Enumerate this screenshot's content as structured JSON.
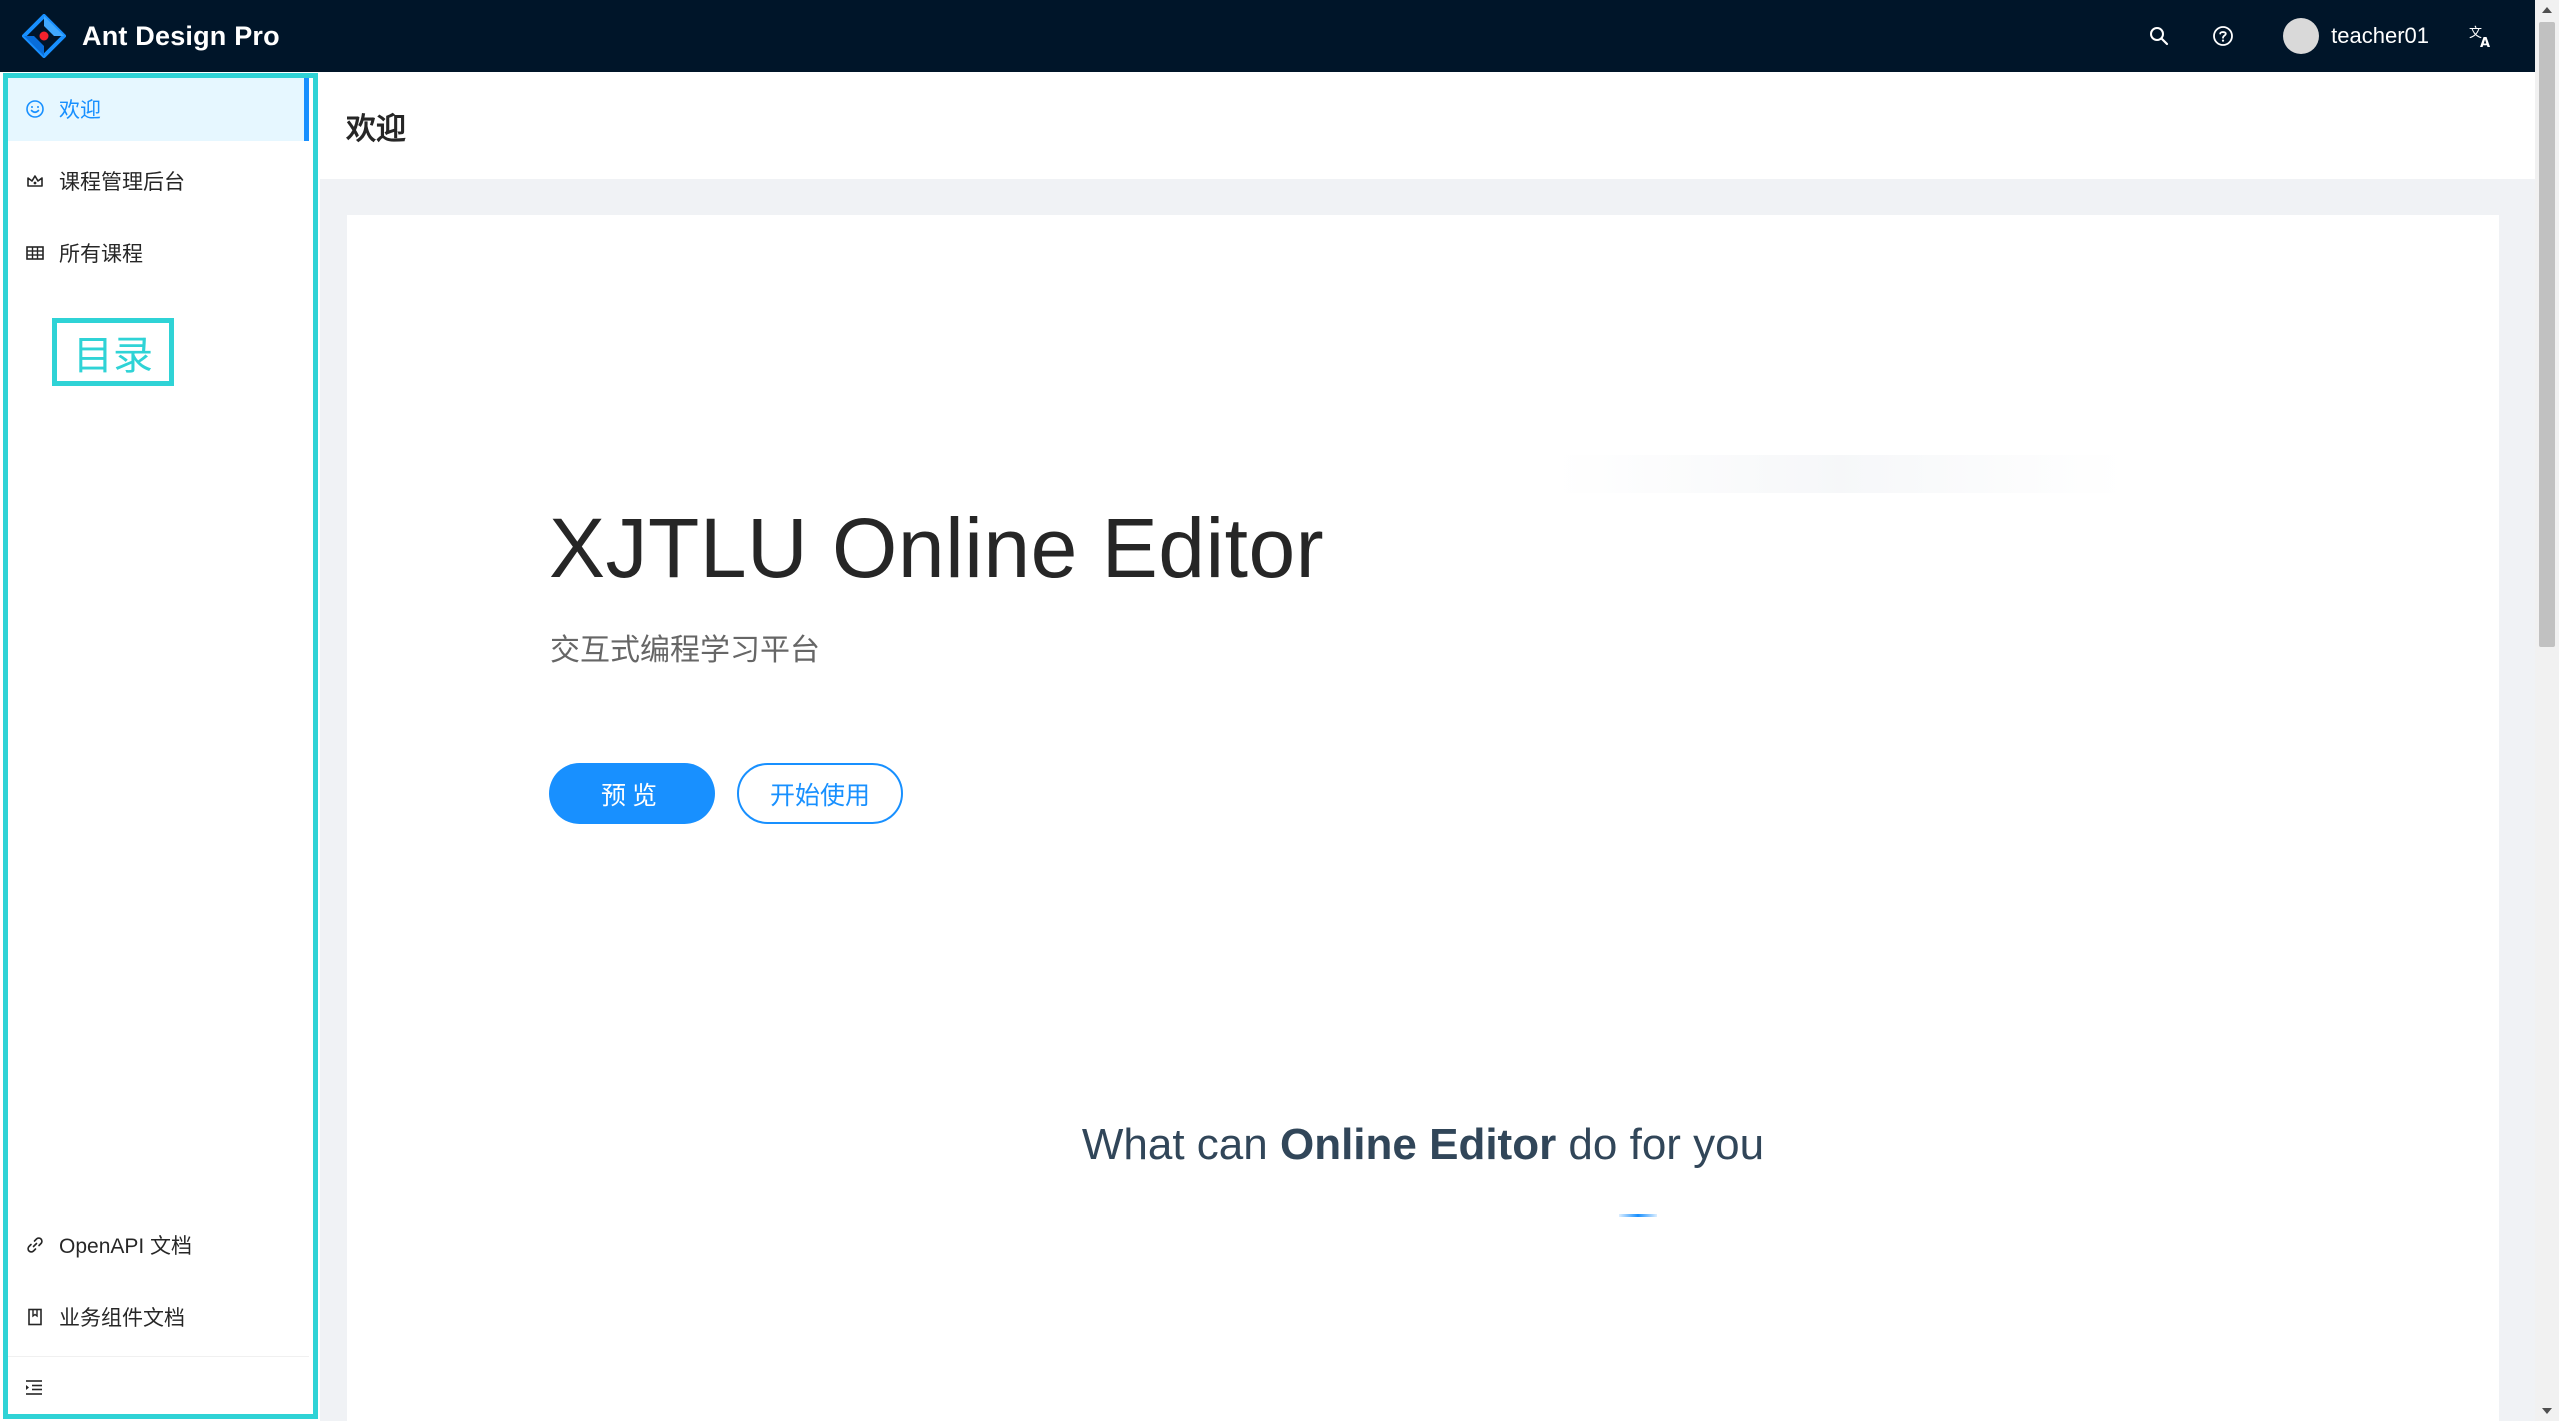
{
  "header": {
    "app_title": "Ant Design Pro",
    "username": "teacher01",
    "icons": [
      "search-icon",
      "question-circle-icon",
      "translation-icon"
    ]
  },
  "sidebar": {
    "items": [
      {
        "label": "欢迎",
        "icon": "smile-icon",
        "selected": true
      },
      {
        "label": "课程管理后台",
        "icon": "crown-icon",
        "selected": false
      },
      {
        "label": "所有课程",
        "icon": "table-icon",
        "selected": false
      }
    ],
    "footer_items": [
      {
        "label": "OpenAPI 文档",
        "icon": "link-icon"
      },
      {
        "label": "业务组件文档",
        "icon": "book-icon"
      }
    ],
    "annotation_label": "目录",
    "collapse_icon": "menu-fold-icon"
  },
  "page": {
    "title": "欢迎"
  },
  "hero": {
    "title": "XJTLU Online Editor",
    "subtitle": "交互式编程学习平台",
    "primary_button": "预览",
    "secondary_button": "开始使用"
  },
  "feature": {
    "prefix": "What can ",
    "highlight": "Online Editor",
    "suffix": " do for you"
  },
  "colors": {
    "header_bg": "#001529",
    "accent": "#1890ff",
    "annotation": "#2fd3d6",
    "selected_bg": "#e6f7ff"
  }
}
